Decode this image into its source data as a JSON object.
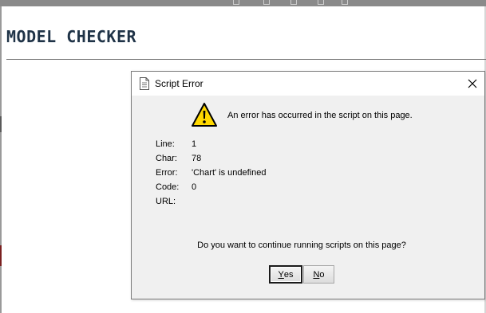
{
  "page": {
    "title": "MODEL CHECKER"
  },
  "dialog": {
    "title": "Script Error",
    "icon": "document-icon",
    "close_glyph": "✕",
    "message": "An error has occurred in the script on this page.",
    "details": [
      {
        "label": "Line:",
        "value": "1"
      },
      {
        "label": "Char:",
        "value": "78"
      },
      {
        "label": "Error:",
        "value": "'Chart' is undefined"
      },
      {
        "label": "Code:",
        "value": "0"
      },
      {
        "label": "URL:",
        "value": ""
      }
    ],
    "question": "Do you want to continue running scripts on this page?",
    "buttons": {
      "yes_mnemonic": "Y",
      "yes_rest": "es",
      "no_mnemonic": "N",
      "no_rest": "o"
    }
  },
  "colors": {
    "title_text": "#1f3347",
    "warning_fill": "#ffd800",
    "dialog_background": "#f0f0f0"
  }
}
